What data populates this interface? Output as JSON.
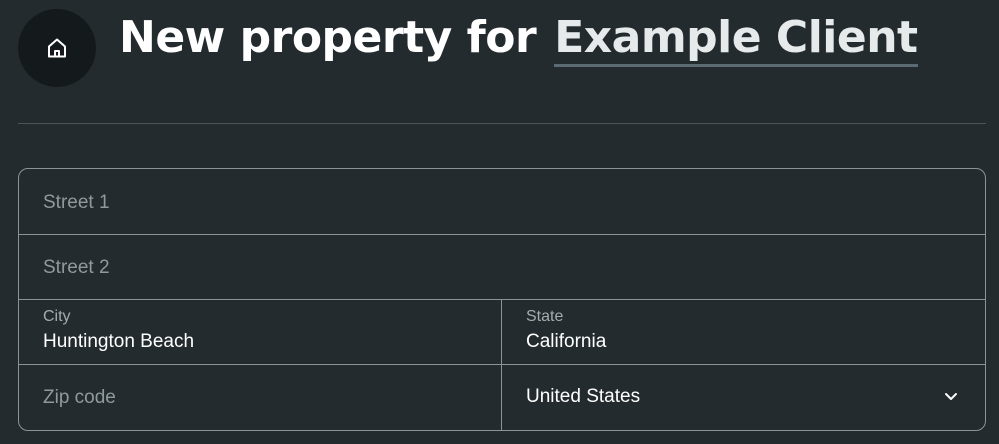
{
  "header": {
    "title_prefix": "New property for",
    "client_name": "Example Client",
    "home_icon": "home-icon"
  },
  "form": {
    "street1": {
      "placeholder": "Street 1",
      "value": ""
    },
    "street2": {
      "placeholder": "Street 2",
      "value": ""
    },
    "city": {
      "label": "City",
      "value": "Huntington Beach"
    },
    "state": {
      "label": "State",
      "value": "California"
    },
    "zip": {
      "placeholder": "Zip code",
      "value": ""
    },
    "country": {
      "selected": "United States",
      "icon": "chevron-down-icon"
    }
  },
  "colors": {
    "background": "#232b2e",
    "home_button": "#141a1c",
    "border": "#8a9598",
    "divider": "#4a5558"
  }
}
